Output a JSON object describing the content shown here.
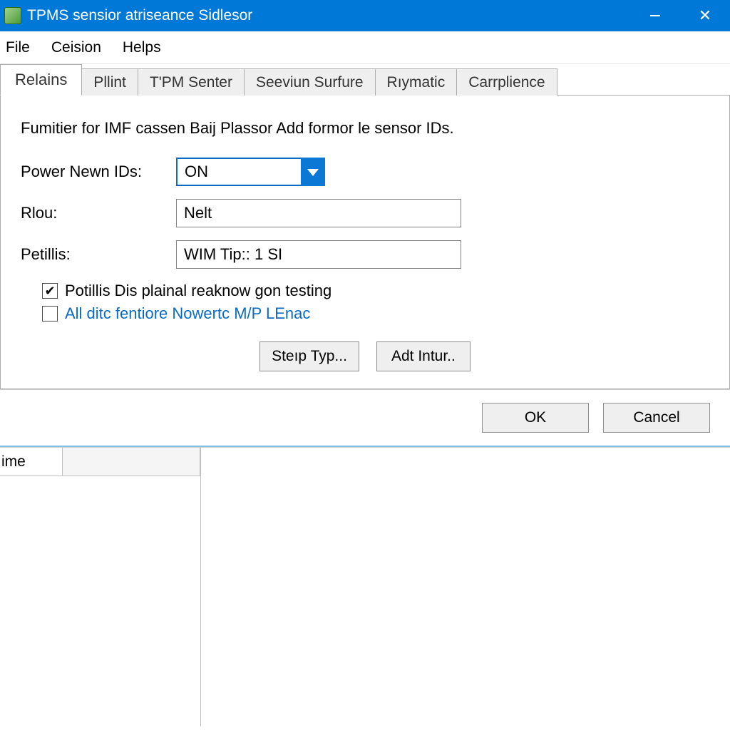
{
  "window": {
    "title": "TPMS sensior atriseance Sidlesor"
  },
  "menu": {
    "file": "File",
    "ceision": "Ceision",
    "helps": "Helps"
  },
  "tabs": [
    "Relains",
    "Pllint",
    "T'PM Senter",
    "Seeviun Surfure",
    "Rıymatic",
    "Carrplience"
  ],
  "form": {
    "description": "Fumitier for IMF cassen Baij Plassor Add formor le sensor IDs.",
    "power_label": "Power Newn IDs:",
    "power_value": "ON",
    "rlou_label": "Rlou:",
    "rlou_value": "Nelt",
    "petillis_label": "Petillis:",
    "petillis_value": "WIM Tip:: 1 SI",
    "check1_label": "Potillis Dis plainal reaknow gon testing",
    "check2_label": "All ditc fentiore Nowertc M/P LEnac"
  },
  "buttons": {
    "steip": "Steıp Typ...",
    "adt": "Adt Intur..",
    "ok": "OK",
    "cancel": "Cancel"
  },
  "lower": {
    "col1": "ime"
  }
}
